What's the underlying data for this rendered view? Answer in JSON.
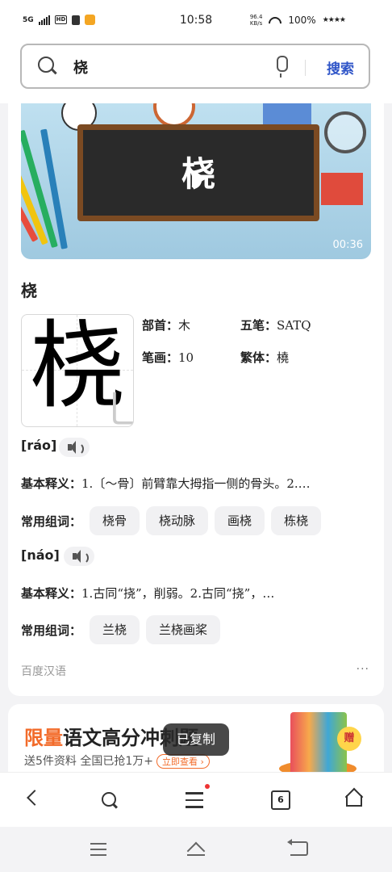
{
  "status": {
    "network": "5G",
    "hd": "HD",
    "time": "10:58",
    "speed_value": "96.4",
    "speed_unit": "KB/s",
    "battery": "100%",
    "stars": "★★★★"
  },
  "search": {
    "query": "桡",
    "button": "搜索"
  },
  "video": {
    "board_char": "桡",
    "duration": "00:36"
  },
  "entry": {
    "char": "桡",
    "radical_label": "部首：",
    "radical": "木",
    "wubi_label": "五笔：",
    "wubi": "SATQ",
    "strokes_label": "笔画：",
    "strokes": "10",
    "traditional_label": "繁体：",
    "traditional": "橈"
  },
  "readings": [
    {
      "pinyin": "[ráo]",
      "def_label": "基本释义：",
      "def": "1.〔～骨〕前臂靠大拇指一侧的骨头。2.…",
      "words_label": "常用组词：",
      "words": [
        "桡骨",
        "桡动脉",
        "画桡",
        "栋桡"
      ]
    },
    {
      "pinyin": "[náo]",
      "def_label": "基本释义：",
      "def": "1.古同“挠”，削弱。2.古同“挠”，…",
      "words_label": "常用组词：",
      "words": [
        "兰桡",
        "兰桡画桨"
      ]
    }
  ],
  "source": "百度汉语",
  "more": "···",
  "ad": {
    "title_red": "限量",
    "title": "语文高分冲刺题",
    "subtitle": "送5件资料 全国已抢1万+",
    "tag": "立即查看 ›",
    "gift": "赠"
  },
  "toast": "已复制",
  "nav": {
    "tabs_count": "6"
  },
  "colors": {
    "accent": "#2f55c8",
    "ad_red": "#f26b2a",
    "badge": "#e33"
  }
}
